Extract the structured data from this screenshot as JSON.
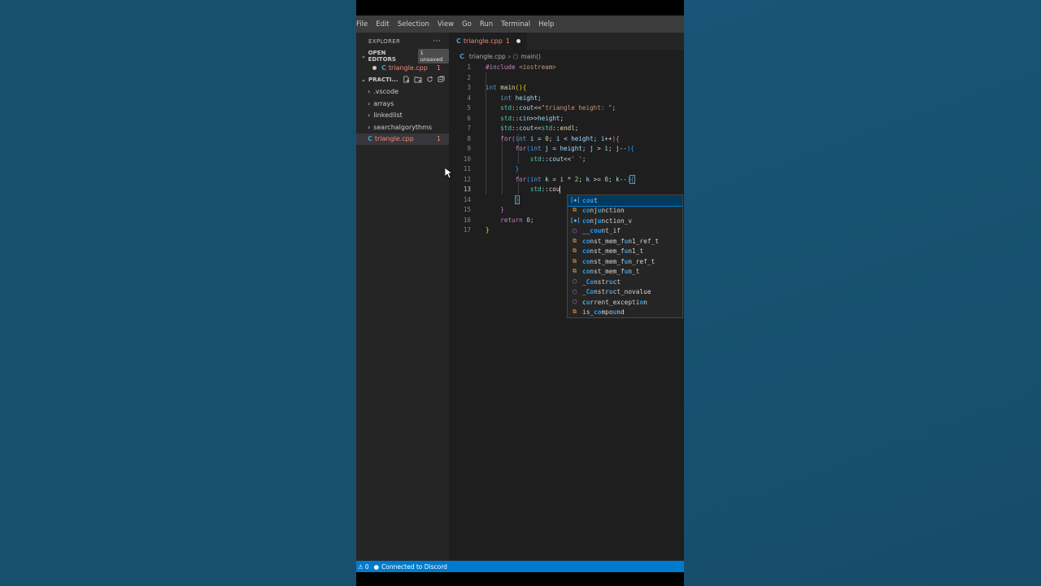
{
  "menubar": {
    "items": [
      "File",
      "Edit",
      "Selection",
      "View",
      "Go",
      "Run",
      "Terminal",
      "Help"
    ]
  },
  "sidebar": {
    "title": "EXPLORER",
    "more_icon": "ellipsis-icon",
    "open_editors": {
      "label": "OPEN EDITORS",
      "badge": "1 unsaved",
      "file": {
        "name": "triangle.cpp",
        "problems": "1"
      }
    },
    "project": {
      "label": "PRACTI...",
      "actions": [
        "new-file-icon",
        "new-folder-icon",
        "refresh-icon",
        "collapse-icon"
      ],
      "folders": [
        ".vscode",
        "arrays",
        "linkedlist",
        "searchalgorythms"
      ],
      "file": {
        "name": "triangle.cpp",
        "problems": "1"
      }
    }
  },
  "editor": {
    "tab": {
      "name": "triangle.cpp",
      "problems": "1"
    },
    "breadcrumb": {
      "file": "triangle.cpp",
      "symbol": "main()"
    },
    "line_numbers": [
      "1",
      "2",
      "3",
      "4",
      "5",
      "6",
      "7",
      "8",
      "9",
      "10",
      "11",
      "12",
      "13",
      "14",
      "15",
      "16",
      "17"
    ],
    "current_line": "13"
  },
  "suggest": {
    "items": [
      {
        "label": "cout",
        "kind": "variable",
        "detail": ""
      },
      {
        "label": "conjunction",
        "kind": "type",
        "detail": ""
      },
      {
        "label": "conjunction_v",
        "kind": "variable",
        "detail": ""
      },
      {
        "label": "__count_if",
        "kind": "class",
        "detail": ""
      },
      {
        "label": "const_mem_fun1_ref_t",
        "kind": "type",
        "detail": ""
      },
      {
        "label": "const_mem_fun1_t",
        "kind": "type",
        "detail": ""
      },
      {
        "label": "const_mem_fun_ref_t",
        "kind": "type",
        "detail": ""
      },
      {
        "label": "const_mem_fun_t",
        "kind": "type",
        "detail": ""
      },
      {
        "label": "_Construct",
        "kind": "class",
        "detail": ""
      },
      {
        "label": "_Construct_novalue",
        "kind": "class",
        "detail": ""
      },
      {
        "label": "current_exception",
        "kind": "class",
        "detail": ""
      },
      {
        "label": "is_compound",
        "kind": "type",
        "detail": ""
      }
    ]
  },
  "statusbar": {
    "problems": "0",
    "discord": "Connected to Discord"
  },
  "colors": {
    "accent": "#007acc",
    "error_file": "#f48771"
  }
}
